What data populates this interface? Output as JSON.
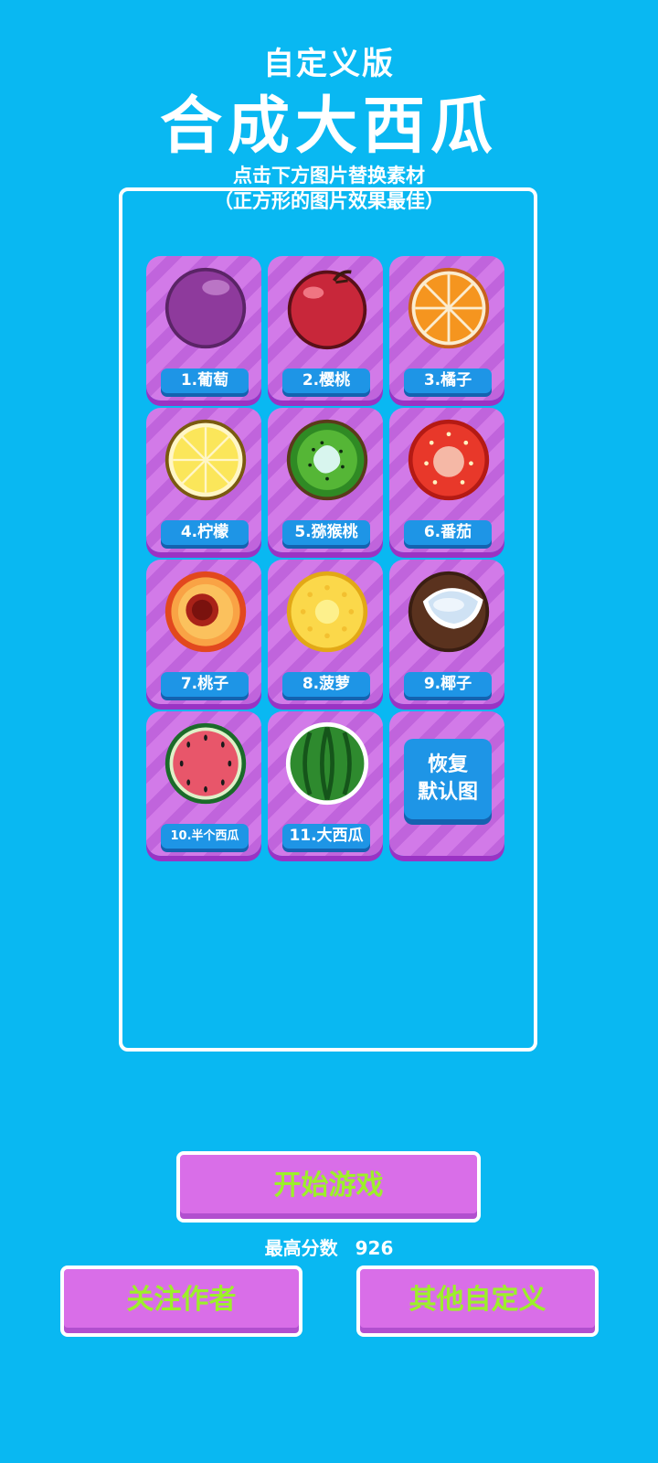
{
  "header": {
    "subtitle": "自定义版",
    "title": "合成大西瓜",
    "hint_line1": "点击下方图片替换素材",
    "hint_line2": "（正方形的图片效果最佳）"
  },
  "fruits": [
    {
      "label": "1.葡萄",
      "icon": "grape-icon"
    },
    {
      "label": "2.樱桃",
      "icon": "cherry-icon"
    },
    {
      "label": "3.橘子",
      "icon": "orange-icon"
    },
    {
      "label": "4.柠檬",
      "icon": "lemon-icon"
    },
    {
      "label": "5.猕猴桃",
      "icon": "kiwi-icon"
    },
    {
      "label": "6.番茄",
      "icon": "tomato-icon"
    },
    {
      "label": "7.桃子",
      "icon": "peach-icon"
    },
    {
      "label": "8.菠萝",
      "icon": "pineapple-icon"
    },
    {
      "label": "9.椰子",
      "icon": "coconut-icon"
    },
    {
      "label": "10.半个西瓜",
      "icon": "half-watermelon-icon"
    },
    {
      "label": "11.大西瓜",
      "icon": "watermelon-icon"
    }
  ],
  "restore": {
    "line1": "恢复",
    "line2": "默认图"
  },
  "buttons": {
    "start": "开始游戏",
    "follow": "关注作者",
    "other": "其他自定义"
  },
  "score": {
    "label": "最高分数",
    "value": "926"
  },
  "colors": {
    "background": "#09b8f2",
    "card": "#d27ae8",
    "label": "#1e95e6",
    "button_text": "#9cf02a"
  }
}
